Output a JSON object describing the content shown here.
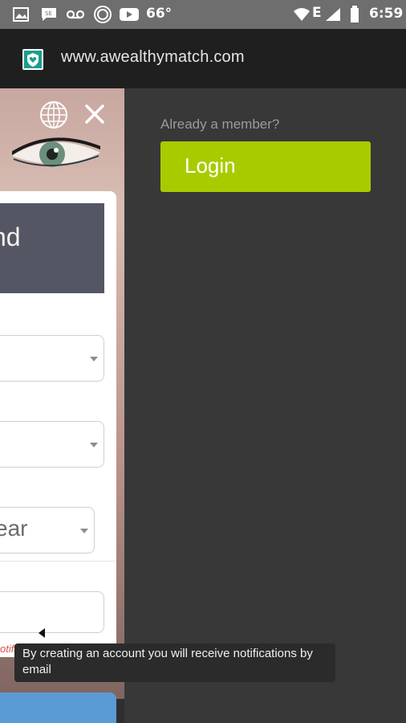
{
  "status_bar": {
    "temperature": "66°",
    "time": "6:59",
    "network": "E",
    "icons": [
      "image-icon",
      "chat-icon",
      "voicemail-icon",
      "stumbleupon-icon",
      "youtube-icon",
      "wifi-icon",
      "signal-icon",
      "battery-icon"
    ]
  },
  "browser": {
    "url": "www.awealthymatch.com",
    "site_icon": "shield-heart-icon"
  },
  "right_panel": {
    "already_member": "Already a member?",
    "login_label": "Login",
    "login_color": "#a8cb00"
  },
  "form": {
    "header_text": "nd",
    "year_placeholder": "ear",
    "notification_partial": "otifications by"
  },
  "tooltip": {
    "text": "By creating an account you will receive notifications by email"
  },
  "colors": {
    "background": "#383838",
    "submit": "#5b9bd5",
    "header_box": "#545763"
  }
}
